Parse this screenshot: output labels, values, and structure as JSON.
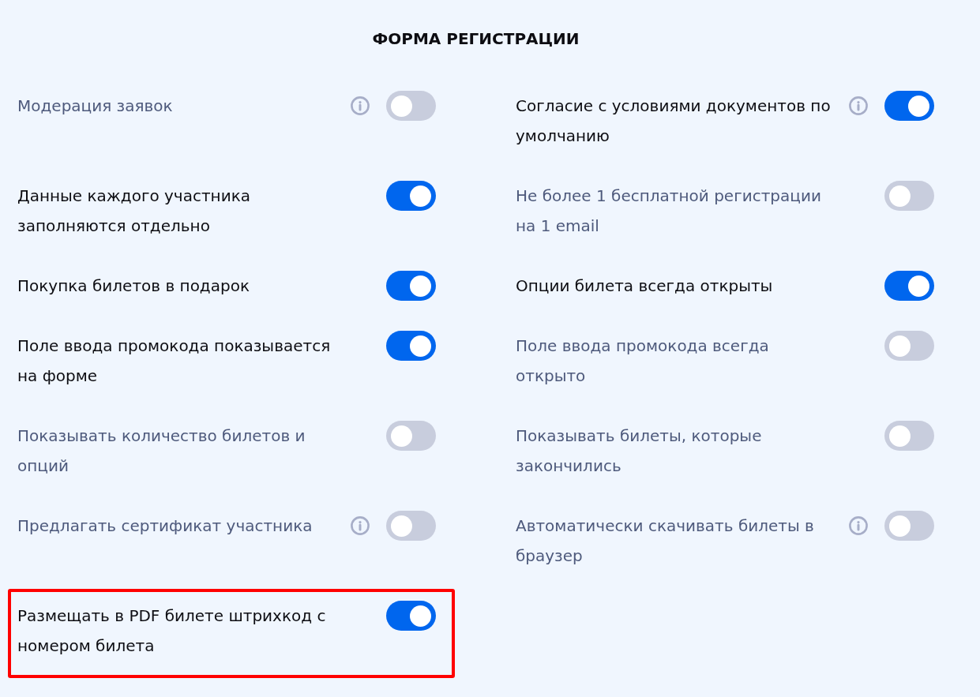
{
  "title": "ФОРМА РЕГИСТРАЦИИ",
  "settings": [
    {
      "label": "Модерация заявок",
      "info": true,
      "on": false,
      "highlighted": false
    },
    {
      "label": "Согласие с условиями документов по умолчанию",
      "info": true,
      "on": true,
      "highlighted": false
    },
    {
      "label": "Данные каждого участника заполняются отдельно",
      "info": false,
      "on": true,
      "highlighted": false
    },
    {
      "label": "Не более 1 бесплатной регистрации на 1 email",
      "info": false,
      "on": false,
      "highlighted": false
    },
    {
      "label": "Покупка билетов в подарок",
      "info": false,
      "on": true,
      "highlighted": false
    },
    {
      "label": "Опции билета всегда открыты",
      "info": false,
      "on": true,
      "highlighted": false
    },
    {
      "label": "Поле ввода промокода показывается на форме",
      "info": false,
      "on": true,
      "highlighted": false
    },
    {
      "label": "Поле ввода промокода всегда открыто",
      "info": false,
      "on": false,
      "highlighted": false
    },
    {
      "label": "Показывать количество билетов и опций",
      "info": false,
      "on": false,
      "highlighted": false
    },
    {
      "label": "Показывать билеты, которые закончились",
      "info": false,
      "on": false,
      "highlighted": false
    },
    {
      "label": "Предлагать сертификат участника",
      "info": true,
      "on": false,
      "highlighted": false
    },
    {
      "label": "Автоматически скачивать билеты в браузер",
      "info": true,
      "on": false,
      "highlighted": false
    },
    {
      "label": "Размещать в PDF билете штрихкод с номером билета",
      "info": false,
      "on": true,
      "highlighted": true
    }
  ]
}
